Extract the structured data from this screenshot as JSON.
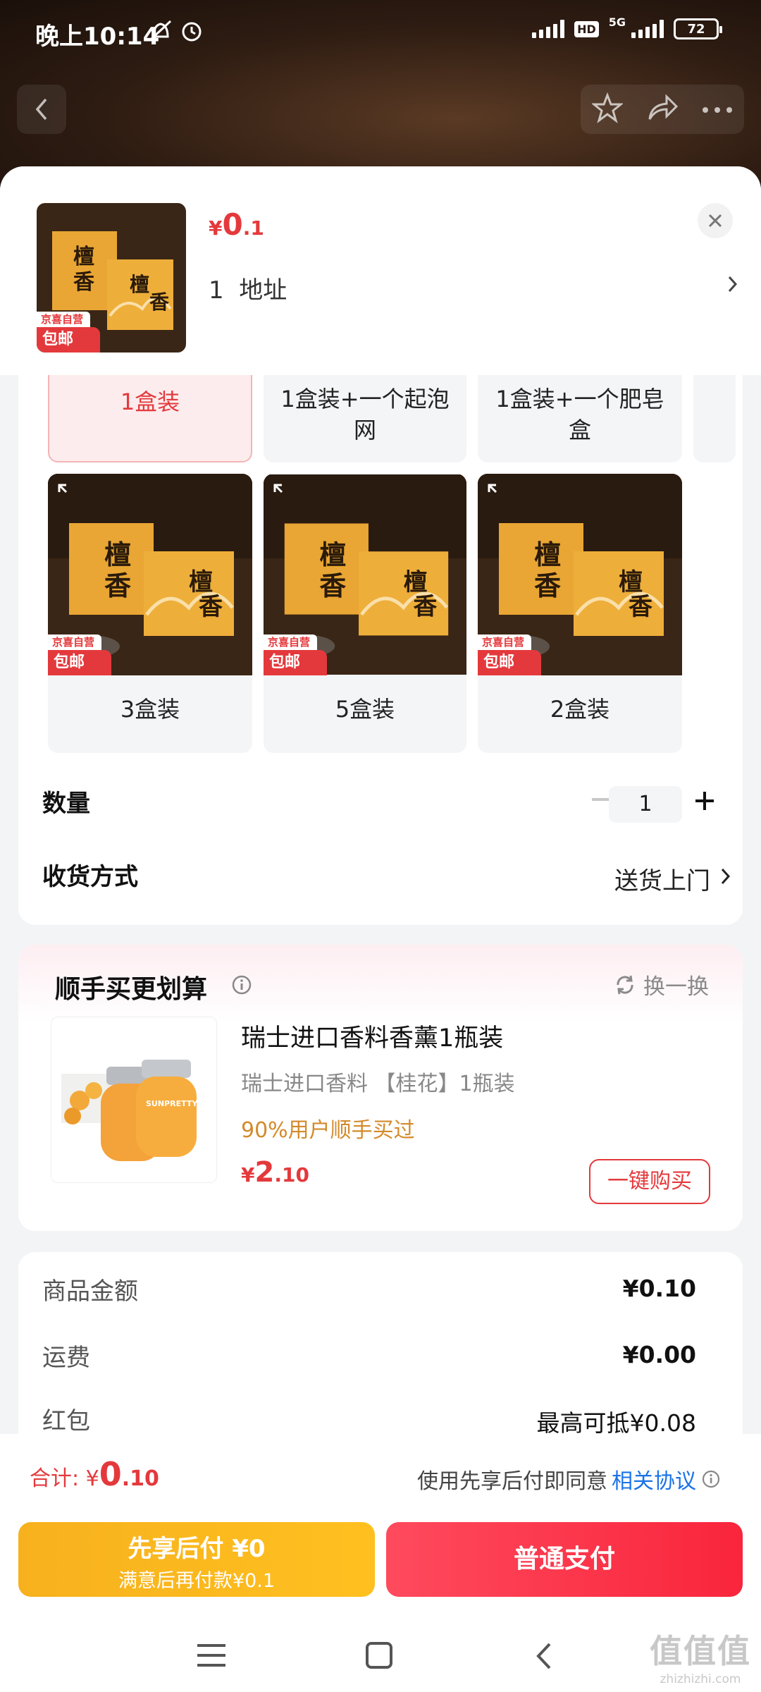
{
  "status_bar": {
    "time": "晚上10:14",
    "hd": "HD",
    "network": "5G",
    "battery": "72"
  },
  "product": {
    "price_symbol": "¥",
    "price_int": "0",
    "price_dec": ".1",
    "address_prefix": "1",
    "address_label": "地址",
    "badge_top": "京喜自营",
    "badge_bottom": "包邮",
    "box_text_1": "檀",
    "box_text_2": "香"
  },
  "specs": {
    "text_options": [
      {
        "label": "1盒装",
        "selected": true
      },
      {
        "label": "1盒装+一个起泡网",
        "selected": false
      },
      {
        "label": "1盒装+一个肥皂盒",
        "selected": false
      }
    ],
    "image_options": [
      {
        "label": "3盒装",
        "badge_top": "京喜自营",
        "badge_bottom": "包邮"
      },
      {
        "label": "5盒装",
        "badge_top": "京喜自营",
        "badge_bottom": "包邮"
      },
      {
        "label": "2盒装",
        "badge_top": "京喜自营",
        "badge_bottom": "包邮"
      }
    ]
  },
  "quantity": {
    "label": "数量",
    "value": "1"
  },
  "delivery": {
    "label": "收货方式",
    "value": "送货上门"
  },
  "upsell": {
    "title": "顺手买更划算",
    "swap_label": "换一换",
    "item_name": "瑞士进口香料香薰1瓶装",
    "item_desc": "瑞士进口香料 【桂花】1瓶装",
    "item_note": "90%用户顺手买过",
    "price_symbol": "¥",
    "price_int": "2",
    "price_dec": ".10",
    "buy_label": "一键购买",
    "bottle_brand": "SUNPRETTY"
  },
  "amounts": {
    "goods_label": "商品金额",
    "goods_value": "¥0.10",
    "shipping_label": "运费",
    "shipping_value": "¥0.00",
    "redpack_label": "红包",
    "redpack_value": "最高可抵¥0.08"
  },
  "bottom": {
    "total_label": "合计:",
    "total_symbol": "¥",
    "total_int": "0",
    "total_dec": ".10",
    "agree_text": "使用先享后付即同意",
    "agree_link": "相关协议",
    "pay_later_line1": "先享后付 ¥0",
    "pay_later_line2": "满意后再付款¥0.1",
    "pay_normal": "普通支付"
  },
  "watermark": {
    "line1": "值值值",
    "line2": "zhizhizhi.com"
  },
  "colors": {
    "accent_red": "#e4393c",
    "pay_later": "#ffc01f",
    "pay_normal": "#f9253c",
    "link": "#1a73e8"
  }
}
